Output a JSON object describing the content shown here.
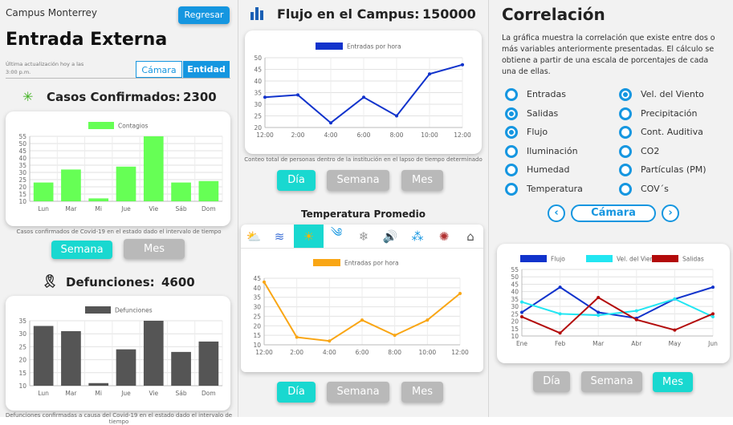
{
  "sidebar": {
    "campus": "Campus Monterrey",
    "back_button": "Regresar",
    "title": "Entrada Externa",
    "update_text": "Última actualización hoy a las 3:00 p.m.",
    "tabs": [
      "Cámara",
      "Entidad"
    ],
    "active_tab": "Entidad"
  },
  "confirmed": {
    "label": "Casos Confirmados:",
    "value": "2300",
    "caption": "Casos confirmados de Covid-19 en el estado dado el intervalo de tiempo",
    "buttons": [
      "Semana",
      "Mes"
    ]
  },
  "deaths": {
    "label": "Defunciones:",
    "value": "4600",
    "caption": "Defunciones confirmadas a causa del Covid-19 en el estado dado el intervalo de tiempo"
  },
  "flow": {
    "label": "Flujo en el Campus:",
    "value": "150000",
    "caption": "Conteo total de personas dentro de la institución en el lapso de tiempo determinado",
    "buttons": [
      "Día",
      "Semana",
      "Mes"
    ]
  },
  "temperature": {
    "title": "Temperatura Promedio",
    "buttons": [
      "Día",
      "Semana",
      "Mes"
    ],
    "icons": [
      "sun-cloud-icon",
      "fog-icon",
      "sun-icon",
      "wind-icon",
      "snow-icon",
      "sound-icon",
      "particles-icon",
      "virus-icon",
      "building-icon"
    ]
  },
  "correlation": {
    "title": "Correlación",
    "description": "La gráfica muestra la correlación que existe entre dos o más variables anteriormente presentadas. El cálculo se obtiene a partir de una escala de porcentajes de cada una de ellas.",
    "options_left": [
      {
        "label": "Entradas",
        "checked": false
      },
      {
        "label": "Salidas",
        "checked": true
      },
      {
        "label": "Flujo",
        "checked": true
      },
      {
        "label": "Iluminación",
        "checked": false
      },
      {
        "label": "Humedad",
        "checked": false
      },
      {
        "label": "Temperatura",
        "checked": false
      }
    ],
    "options_right": [
      {
        "label": "Vel. del Viento",
        "checked": true
      },
      {
        "label": "Precipitación",
        "checked": false
      },
      {
        "label": "Cont. Auditiva",
        "checked": false
      },
      {
        "label": "CO2",
        "checked": false
      },
      {
        "label": "Partículas (PM)",
        "checked": false
      },
      {
        "label": "COV´s",
        "checked": false
      }
    ],
    "source_label": "Cámara",
    "buttons": [
      "Día",
      "Semana",
      "Mes"
    ]
  },
  "colors": {
    "teal": "#19d8d0",
    "grey": "#b9b9b9",
    "green": "#66ff55",
    "dark": "#555555",
    "blue": "#1133cc",
    "orange": "#f9a615",
    "cyan": "#22e6f2",
    "red": "#b30b0b",
    "radio": "#1596e0"
  },
  "chart_data": [
    {
      "id": "contagios",
      "type": "bar",
      "categories": [
        "Lun",
        "Mar",
        "Mi",
        "Jue",
        "Vie",
        "Sáb",
        "Dom"
      ],
      "series": [
        {
          "name": "Contagios",
          "values": [
            23,
            32,
            12,
            34,
            55,
            23,
            24
          ]
        }
      ],
      "ylim": [
        10,
        55
      ],
      "yticks": [
        10,
        15,
        20,
        25,
        30,
        35,
        40,
        45,
        50,
        55
      ],
      "legend": "top"
    },
    {
      "id": "defunciones",
      "type": "bar",
      "categories": [
        "Lun",
        "Mar",
        "Mi",
        "Jue",
        "Vie",
        "Sáb",
        "Dom"
      ],
      "series": [
        {
          "name": "Defunciones",
          "values": [
            33,
            31,
            11,
            24,
            35,
            23,
            27
          ]
        }
      ],
      "ylim": [
        10,
        35
      ],
      "yticks": [
        10,
        15,
        20,
        25,
        30,
        35
      ],
      "legend": "top"
    },
    {
      "id": "flujo",
      "type": "line",
      "categories": [
        "12:00",
        "2:00",
        "4:00",
        "6:00",
        "8:00",
        "10:00",
        "12:00"
      ],
      "series": [
        {
          "name": "Entradas por hora",
          "values": [
            33,
            34,
            22,
            33,
            25,
            43,
            47
          ]
        }
      ],
      "ylim": [
        20,
        50
      ],
      "yticks": [
        20,
        25,
        30,
        35,
        40,
        45,
        50
      ],
      "legend": "top"
    },
    {
      "id": "temperatura",
      "type": "line",
      "categories": [
        "12:00",
        "2:00",
        "4:00",
        "6:00",
        "8:00",
        "10:00",
        "12:00"
      ],
      "series": [
        {
          "name": "Entradas por hora",
          "values": [
            43,
            14,
            12,
            23,
            15,
            23,
            37
          ]
        }
      ],
      "ylim": [
        10,
        45
      ],
      "yticks": [
        10,
        15,
        20,
        25,
        30,
        35,
        40,
        45
      ],
      "legend": "top"
    },
    {
      "id": "correlacion",
      "type": "line",
      "categories": [
        "Ene",
        "Feb",
        "Mar",
        "Abr",
        "May",
        "Jun"
      ],
      "series": [
        {
          "name": "Flujo",
          "values": [
            26,
            43,
            26,
            22,
            35,
            43
          ]
        },
        {
          "name": "Vel. del Viento",
          "values": [
            33,
            25,
            24,
            27,
            35,
            23
          ]
        },
        {
          "name": "Salidas",
          "values": [
            23,
            12,
            36,
            21,
            14,
            25
          ]
        }
      ],
      "ylim": [
        10,
        55
      ],
      "yticks": [
        10,
        15,
        20,
        25,
        30,
        35,
        40,
        45,
        50,
        55
      ],
      "legend": "top"
    }
  ]
}
